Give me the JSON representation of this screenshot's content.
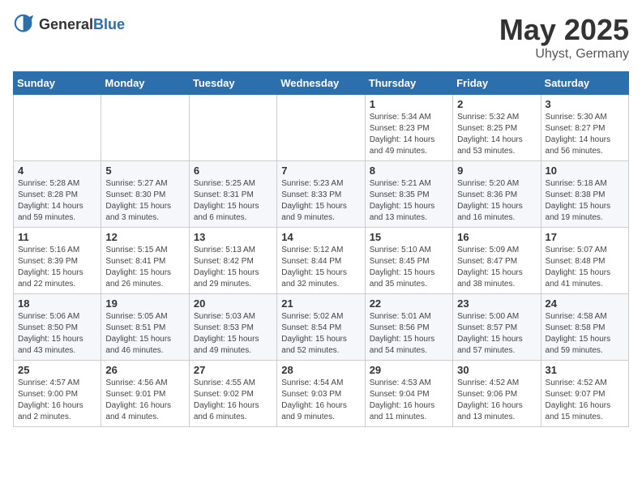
{
  "header": {
    "logo_general": "General",
    "logo_blue": "Blue",
    "title": "May 2025",
    "location": "Uhyst, Germany"
  },
  "weekdays": [
    "Sunday",
    "Monday",
    "Tuesday",
    "Wednesday",
    "Thursday",
    "Friday",
    "Saturday"
  ],
  "weeks": [
    [
      {
        "day": "",
        "info": ""
      },
      {
        "day": "",
        "info": ""
      },
      {
        "day": "",
        "info": ""
      },
      {
        "day": "",
        "info": ""
      },
      {
        "day": "1",
        "info": "Sunrise: 5:34 AM\nSunset: 8:23 PM\nDaylight: 14 hours\nand 49 minutes."
      },
      {
        "day": "2",
        "info": "Sunrise: 5:32 AM\nSunset: 8:25 PM\nDaylight: 14 hours\nand 53 minutes."
      },
      {
        "day": "3",
        "info": "Sunrise: 5:30 AM\nSunset: 8:27 PM\nDaylight: 14 hours\nand 56 minutes."
      }
    ],
    [
      {
        "day": "4",
        "info": "Sunrise: 5:28 AM\nSunset: 8:28 PM\nDaylight: 14 hours\nand 59 minutes."
      },
      {
        "day": "5",
        "info": "Sunrise: 5:27 AM\nSunset: 8:30 PM\nDaylight: 15 hours\nand 3 minutes."
      },
      {
        "day": "6",
        "info": "Sunrise: 5:25 AM\nSunset: 8:31 PM\nDaylight: 15 hours\nand 6 minutes."
      },
      {
        "day": "7",
        "info": "Sunrise: 5:23 AM\nSunset: 8:33 PM\nDaylight: 15 hours\nand 9 minutes."
      },
      {
        "day": "8",
        "info": "Sunrise: 5:21 AM\nSunset: 8:35 PM\nDaylight: 15 hours\nand 13 minutes."
      },
      {
        "day": "9",
        "info": "Sunrise: 5:20 AM\nSunset: 8:36 PM\nDaylight: 15 hours\nand 16 minutes."
      },
      {
        "day": "10",
        "info": "Sunrise: 5:18 AM\nSunset: 8:38 PM\nDaylight: 15 hours\nand 19 minutes."
      }
    ],
    [
      {
        "day": "11",
        "info": "Sunrise: 5:16 AM\nSunset: 8:39 PM\nDaylight: 15 hours\nand 22 minutes."
      },
      {
        "day": "12",
        "info": "Sunrise: 5:15 AM\nSunset: 8:41 PM\nDaylight: 15 hours\nand 26 minutes."
      },
      {
        "day": "13",
        "info": "Sunrise: 5:13 AM\nSunset: 8:42 PM\nDaylight: 15 hours\nand 29 minutes."
      },
      {
        "day": "14",
        "info": "Sunrise: 5:12 AM\nSunset: 8:44 PM\nDaylight: 15 hours\nand 32 minutes."
      },
      {
        "day": "15",
        "info": "Sunrise: 5:10 AM\nSunset: 8:45 PM\nDaylight: 15 hours\nand 35 minutes."
      },
      {
        "day": "16",
        "info": "Sunrise: 5:09 AM\nSunset: 8:47 PM\nDaylight: 15 hours\nand 38 minutes."
      },
      {
        "day": "17",
        "info": "Sunrise: 5:07 AM\nSunset: 8:48 PM\nDaylight: 15 hours\nand 41 minutes."
      }
    ],
    [
      {
        "day": "18",
        "info": "Sunrise: 5:06 AM\nSunset: 8:50 PM\nDaylight: 15 hours\nand 43 minutes."
      },
      {
        "day": "19",
        "info": "Sunrise: 5:05 AM\nSunset: 8:51 PM\nDaylight: 15 hours\nand 46 minutes."
      },
      {
        "day": "20",
        "info": "Sunrise: 5:03 AM\nSunset: 8:53 PM\nDaylight: 15 hours\nand 49 minutes."
      },
      {
        "day": "21",
        "info": "Sunrise: 5:02 AM\nSunset: 8:54 PM\nDaylight: 15 hours\nand 52 minutes."
      },
      {
        "day": "22",
        "info": "Sunrise: 5:01 AM\nSunset: 8:56 PM\nDaylight: 15 hours\nand 54 minutes."
      },
      {
        "day": "23",
        "info": "Sunrise: 5:00 AM\nSunset: 8:57 PM\nDaylight: 15 hours\nand 57 minutes."
      },
      {
        "day": "24",
        "info": "Sunrise: 4:58 AM\nSunset: 8:58 PM\nDaylight: 15 hours\nand 59 minutes."
      }
    ],
    [
      {
        "day": "25",
        "info": "Sunrise: 4:57 AM\nSunset: 9:00 PM\nDaylight: 16 hours\nand 2 minutes."
      },
      {
        "day": "26",
        "info": "Sunrise: 4:56 AM\nSunset: 9:01 PM\nDaylight: 16 hours\nand 4 minutes."
      },
      {
        "day": "27",
        "info": "Sunrise: 4:55 AM\nSunset: 9:02 PM\nDaylight: 16 hours\nand 6 minutes."
      },
      {
        "day": "28",
        "info": "Sunrise: 4:54 AM\nSunset: 9:03 PM\nDaylight: 16 hours\nand 9 minutes."
      },
      {
        "day": "29",
        "info": "Sunrise: 4:53 AM\nSunset: 9:04 PM\nDaylight: 16 hours\nand 11 minutes."
      },
      {
        "day": "30",
        "info": "Sunrise: 4:52 AM\nSunset: 9:06 PM\nDaylight: 16 hours\nand 13 minutes."
      },
      {
        "day": "31",
        "info": "Sunrise: 4:52 AM\nSunset: 9:07 PM\nDaylight: 16 hours\nand 15 minutes."
      }
    ]
  ]
}
